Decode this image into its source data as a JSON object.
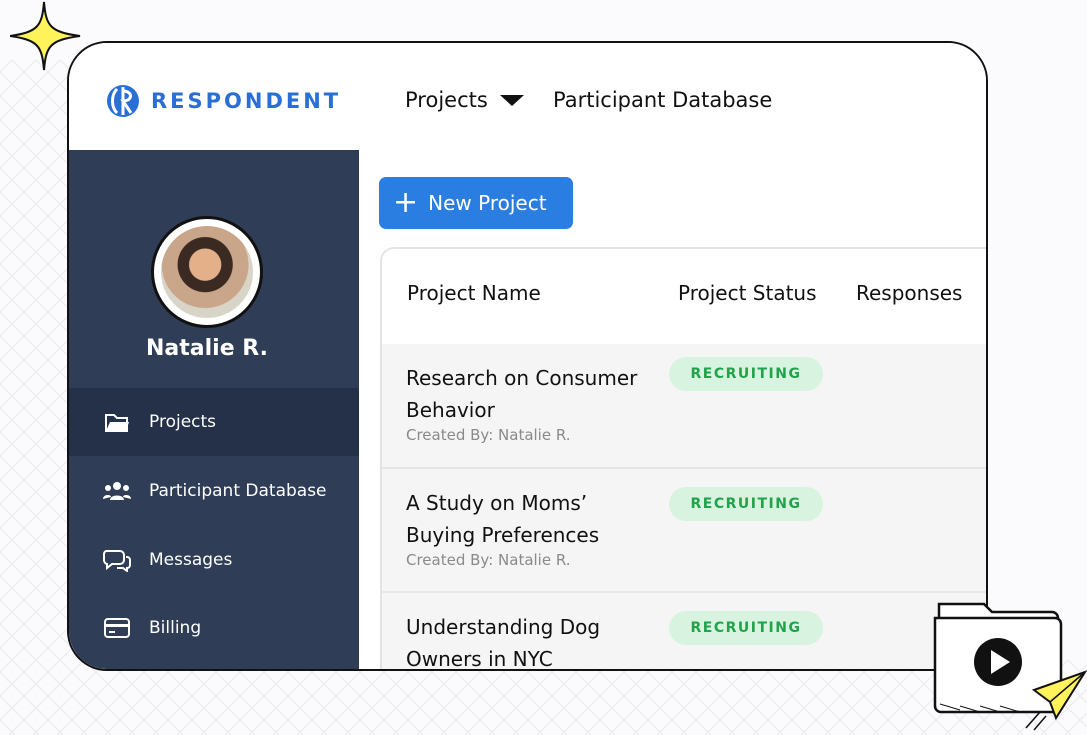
{
  "brand": {
    "name": "RESPONDENT",
    "color": "#2a6fd6"
  },
  "topnav": {
    "projects": "Projects",
    "participant_database": "Participant Database"
  },
  "user": {
    "name": "Natalie R."
  },
  "sidebar": {
    "items": [
      {
        "label": "Projects",
        "icon": "folder-icon",
        "active": true
      },
      {
        "label": "Participant Database",
        "icon": "people-icon",
        "active": false
      },
      {
        "label": "Messages",
        "icon": "chat-icon",
        "active": false
      },
      {
        "label": "Billing",
        "icon": "card-icon",
        "active": false
      }
    ]
  },
  "actions": {
    "new_project": "New Project"
  },
  "table": {
    "columns": [
      "Project Name",
      "Project Status",
      "Responses"
    ],
    "rows": [
      {
        "name": "Research on Consumer Behavior",
        "created_by": "Created By: Natalie R.",
        "status": "RECRUITING"
      },
      {
        "name": "A Study on Moms’ Buying Preferences",
        "created_by": "Created By: Natalie R.",
        "status": "RECRUITING"
      },
      {
        "name": "Understanding Dog Owners in NYC",
        "created_by": "",
        "status": "RECRUITING"
      }
    ]
  },
  "colors": {
    "sidebar": "#2f3e56",
    "sidebar_active": "#243148",
    "primary_button": "#2a7de1",
    "status_bg": "#d8f3df",
    "status_text": "#20a34a"
  }
}
